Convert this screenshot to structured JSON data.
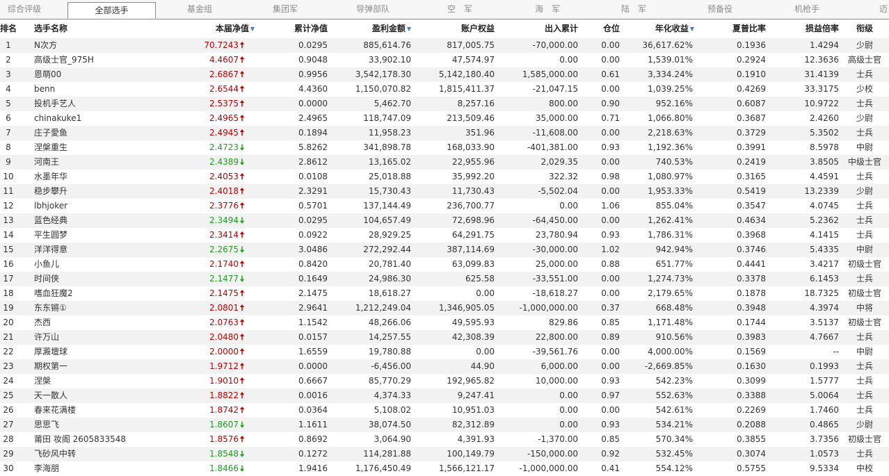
{
  "tabs": [
    {
      "label": "综合评级",
      "active": false
    },
    {
      "label": "全部选手",
      "active": true
    },
    {
      "label": "基金组",
      "active": false
    },
    {
      "label": "集团军",
      "active": false
    },
    {
      "label": "导弹部队",
      "active": false
    },
    {
      "label": "空　军",
      "active": false
    },
    {
      "label": "海　军",
      "active": false
    },
    {
      "label": "陆　军",
      "active": false
    },
    {
      "label": "预备役",
      "active": false
    },
    {
      "label": "机枪手",
      "active": false
    },
    {
      "label": "迈",
      "active": false
    }
  ],
  "headers": {
    "rank": "排名",
    "name": "选手名称",
    "nav": "本届净值",
    "cum": "累计净值",
    "pnl": "盈利金额",
    "equity": "账户权益",
    "flow": "出入累计",
    "position": "仓位",
    "annual": "年化收益",
    "sharpe": "夏普比率",
    "ratio": "损益倍率",
    "rankname": "衔级",
    "sort_icon": "▼"
  },
  "trend_icons": {
    "up": "🠅",
    "down": "🠇"
  },
  "rows": [
    {
      "rank": "1",
      "name": "N次方",
      "nav": "70.7243",
      "dir": "up",
      "cum": "0.0295",
      "pnl": "885,614.76",
      "equity": "817,005.75",
      "flow": "-70,000.00",
      "position": "0.00",
      "annual": "36,617.62%",
      "sharpe": "0.1936",
      "ratio": "1.4294",
      "rankname": "少尉"
    },
    {
      "rank": "2",
      "name": "高级士官_975H",
      "nav": "4.4607",
      "dir": "up",
      "cum": "0.9048",
      "pnl": "33,902.10",
      "equity": "47,574.97",
      "flow": "0.00",
      "position": "0.00",
      "annual": "1,539.01%",
      "sharpe": "0.2924",
      "ratio": "12.3636",
      "rankname": "高级士官"
    },
    {
      "rank": "3",
      "name": "恩萌00",
      "nav": "2.6867",
      "dir": "up",
      "cum": "0.9956",
      "pnl": "3,542,178.30",
      "equity": "5,142,180.40",
      "flow": "1,585,000.00",
      "position": "0.61",
      "annual": "3,334.24%",
      "sharpe": "0.1910",
      "ratio": "31.4139",
      "rankname": "士兵"
    },
    {
      "rank": "4",
      "name": "benn",
      "nav": "2.6544",
      "dir": "up",
      "cum": "4.4360",
      "pnl": "1,150,070.82",
      "equity": "1,815,411.37",
      "flow": "-21,047.15",
      "position": "0.00",
      "annual": "1,039.25%",
      "sharpe": "0.4269",
      "ratio": "33.3175",
      "rankname": "少校"
    },
    {
      "rank": "5",
      "name": "投机手艺人",
      "nav": "2.5375",
      "dir": "up",
      "cum": "0.0000",
      "pnl": "5,462.70",
      "equity": "8,257.16",
      "flow": "800.00",
      "position": "0.90",
      "annual": "952.16%",
      "sharpe": "0.6087",
      "ratio": "10.9722",
      "rankname": "士兵"
    },
    {
      "rank": "6",
      "name": "chinakuke1",
      "nav": "2.4965",
      "dir": "up",
      "cum": "2.4965",
      "pnl": "118,747.09",
      "equity": "213,509.46",
      "flow": "35,000.00",
      "position": "0.71",
      "annual": "1,066.80%",
      "sharpe": "0.3687",
      "ratio": "2.4260",
      "rankname": "少尉"
    },
    {
      "rank": "7",
      "name": "庄子愛鱼",
      "nav": "2.4945",
      "dir": "up",
      "cum": "0.1894",
      "pnl": "11,958.23",
      "equity": "351.96",
      "flow": "-11,608.00",
      "position": "0.00",
      "annual": "2,218.63%",
      "sharpe": "0.3729",
      "ratio": "5.3502",
      "rankname": "士兵"
    },
    {
      "rank": "8",
      "name": "涅槃重生",
      "nav": "2.4723",
      "dir": "down",
      "cum": "5.8262",
      "pnl": "341,898.78",
      "equity": "168,033.90",
      "flow": "-401,381.00",
      "position": "0.93",
      "annual": "1,192.36%",
      "sharpe": "0.3991",
      "ratio": "8.5978",
      "rankname": "中尉"
    },
    {
      "rank": "9",
      "name": "河南王",
      "nav": "2.4389",
      "dir": "down",
      "cum": "2.8612",
      "pnl": "13,165.02",
      "equity": "22,955.96",
      "flow": "2,029.35",
      "position": "0.00",
      "annual": "740.53%",
      "sharpe": "0.2419",
      "ratio": "3.8505",
      "rankname": "中级士官"
    },
    {
      "rank": "10",
      "name": "水墨年华",
      "nav": "2.4053",
      "dir": "up",
      "cum": "0.0108",
      "pnl": "25,018.88",
      "equity": "35,992.20",
      "flow": "322.32",
      "position": "0.98",
      "annual": "1,080.97%",
      "sharpe": "0.3165",
      "ratio": "4.4591",
      "rankname": "士兵"
    },
    {
      "rank": "11",
      "name": "稳步攀升",
      "nav": "2.4018",
      "dir": "up",
      "cum": "2.3291",
      "pnl": "15,730.43",
      "equity": "11,730.43",
      "flow": "-5,502.04",
      "position": "0.00",
      "annual": "1,953.33%",
      "sharpe": "0.5419",
      "ratio": "13.2339",
      "rankname": "少尉"
    },
    {
      "rank": "12",
      "name": "lbhjoker",
      "nav": "2.3776",
      "dir": "up",
      "cum": "0.5701",
      "pnl": "137,144.49",
      "equity": "236,700.77",
      "flow": "0.00",
      "position": "1.06",
      "annual": "855.04%",
      "sharpe": "0.3547",
      "ratio": "4.0745",
      "rankname": "士兵"
    },
    {
      "rank": "13",
      "name": "蓝色经典",
      "nav": "2.3494",
      "dir": "down",
      "cum": "0.0295",
      "pnl": "104,657.49",
      "equity": "72,698.96",
      "flow": "-64,450.00",
      "position": "0.00",
      "annual": "1,262.41%",
      "sharpe": "0.4634",
      "ratio": "5.2362",
      "rankname": "士兵"
    },
    {
      "rank": "14",
      "name": "平生圆梦",
      "nav": "2.3414",
      "dir": "up",
      "cum": "0.0922",
      "pnl": "28,929.25",
      "equity": "64,291.75",
      "flow": "23,780.94",
      "position": "0.93",
      "annual": "1,786.31%",
      "sharpe": "0.3968",
      "ratio": "4.1415",
      "rankname": "士兵"
    },
    {
      "rank": "15",
      "name": "洋洋得意",
      "nav": "2.2675",
      "dir": "down",
      "cum": "3.0486",
      "pnl": "272,292.44",
      "equity": "387,114.69",
      "flow": "-30,000.00",
      "position": "1.02",
      "annual": "942.94%",
      "sharpe": "0.3746",
      "ratio": "5.4335",
      "rankname": "中尉"
    },
    {
      "rank": "16",
      "name": "小鱼儿",
      "nav": "2.1740",
      "dir": "up",
      "cum": "0.8420",
      "pnl": "20,781.40",
      "equity": "63,099.83",
      "flow": "25,000.00",
      "position": "0.88",
      "annual": "651.77%",
      "sharpe": "0.4441",
      "ratio": "3.4217",
      "rankname": "初级士官"
    },
    {
      "rank": "17",
      "name": "时间侠",
      "nav": "2.1477",
      "dir": "down",
      "cum": "0.1649",
      "pnl": "24,986.30",
      "equity": "625.58",
      "flow": "-33,551.00",
      "position": "0.00",
      "annual": "1,274.73%",
      "sharpe": "0.3378",
      "ratio": "6.1453",
      "rankname": "士兵"
    },
    {
      "rank": "18",
      "name": "嗜血狂魔2",
      "nav": "2.1475",
      "dir": "up",
      "cum": "2.1475",
      "pnl": "18,618.27",
      "equity": "0.00",
      "flow": "-18,618.27",
      "position": "0.00",
      "annual": "2,179.65%",
      "sharpe": "0.1878",
      "ratio": "18.7325",
      "rankname": "初级士官"
    },
    {
      "rank": "19",
      "name": "东东锵①",
      "nav": "2.0801",
      "dir": "up",
      "cum": "2.9641",
      "pnl": "1,212,249.04",
      "equity": "1,346,905.05",
      "flow": "-1,000,000.00",
      "position": "0.37",
      "annual": "668.48%",
      "sharpe": "0.3948",
      "ratio": "4.3974",
      "rankname": "中将"
    },
    {
      "rank": "20",
      "name": "杰西",
      "nav": "2.0763",
      "dir": "up",
      "cum": "1.1542",
      "pnl": "48,266.06",
      "equity": "49,595.93",
      "flow": "829.86",
      "position": "0.85",
      "annual": "1,171.48%",
      "sharpe": "0.1744",
      "ratio": "3.5137",
      "rankname": "初级士官"
    },
    {
      "rank": "21",
      "name": "许万山",
      "nav": "2.0480",
      "dir": "up",
      "cum": "0.0157",
      "pnl": "14,257.55",
      "equity": "42,308.39",
      "flow": "22,800.00",
      "position": "0.89",
      "annual": "910.56%",
      "sharpe": "0.3983",
      "ratio": "4.7667",
      "rankname": "士兵"
    },
    {
      "rank": "22",
      "name": "厚澱壇球",
      "nav": "2.0000",
      "dir": "up",
      "cum": "1.6559",
      "pnl": "19,780.88",
      "equity": "0.00",
      "flow": "-39,561.76",
      "position": "0.00",
      "annual": "4,000.00%",
      "sharpe": "0.1569",
      "ratio": "--",
      "rankname": "中尉"
    },
    {
      "rank": "23",
      "name": "期权第一",
      "nav": "1.9712",
      "dir": "up",
      "cum": "0.0000",
      "pnl": "-6,456.00",
      "equity": "44.90",
      "flow": "6,000.00",
      "position": "0.00",
      "annual": "-2,669.85%",
      "sharpe": "0.1630",
      "ratio": "0.1993",
      "rankname": "士兵"
    },
    {
      "rank": "24",
      "name": "涅槃",
      "nav": "1.9010",
      "dir": "up",
      "cum": "0.6667",
      "pnl": "85,770.29",
      "equity": "192,965.82",
      "flow": "10,000.00",
      "position": "0.93",
      "annual": "542.23%",
      "sharpe": "0.3099",
      "ratio": "1.5777",
      "rankname": "士兵"
    },
    {
      "rank": "25",
      "name": "天一散人",
      "nav": "1.8822",
      "dir": "up",
      "cum": "0.0016",
      "pnl": "4,374.33",
      "equity": "9,247.41",
      "flow": "0.00",
      "position": "0.97",
      "annual": "552.63%",
      "sharpe": "0.3388",
      "ratio": "5.0064",
      "rankname": "士兵"
    },
    {
      "rank": "26",
      "name": "春来花满楼",
      "nav": "1.8742",
      "dir": "up",
      "cum": "0.0364",
      "pnl": "5,108.02",
      "equity": "10,951.03",
      "flow": "0.00",
      "position": "0.00",
      "annual": "542.61%",
      "sharpe": "0.2269",
      "ratio": "1.7460",
      "rankname": "士兵"
    },
    {
      "rank": "27",
      "name": "思思飞",
      "nav": "1.8607",
      "dir": "down",
      "cum": "1.1611",
      "pnl": "38,074.50",
      "equity": "82,312.89",
      "flow": "0.00",
      "position": "0.93",
      "annual": "534.21%",
      "sharpe": "0.2088",
      "ratio": "0.4865",
      "rankname": "少尉"
    },
    {
      "rank": "28",
      "name": "莆田 妆阁 2605833548",
      "nav": "1.8576",
      "dir": "up",
      "cum": "0.8692",
      "pnl": "3,064.90",
      "equity": "4,391.93",
      "flow": "-1,370.00",
      "position": "0.85",
      "annual": "570.34%",
      "sharpe": "0.3855",
      "ratio": "3.7356",
      "rankname": "初级士官"
    },
    {
      "rank": "29",
      "name": "飞砂风中转",
      "nav": "1.8548",
      "dir": "down",
      "cum": "0.1272",
      "pnl": "114,281.88",
      "equity": "100,149.79",
      "flow": "-150,000.00",
      "position": "0.92",
      "annual": "532.45%",
      "sharpe": "0.3074",
      "ratio": "1.0573",
      "rankname": "士兵"
    },
    {
      "rank": "30",
      "name": "李海朋",
      "nav": "1.8466",
      "dir": "down",
      "cum": "1.9416",
      "pnl": "1,176,450.49",
      "equity": "1,566,121.17",
      "flow": "-1,000,000.00",
      "position": "0.41",
      "annual": "554.12%",
      "sharpe": "0.5755",
      "ratio": "9.5334",
      "rankname": "中校"
    }
  ]
}
